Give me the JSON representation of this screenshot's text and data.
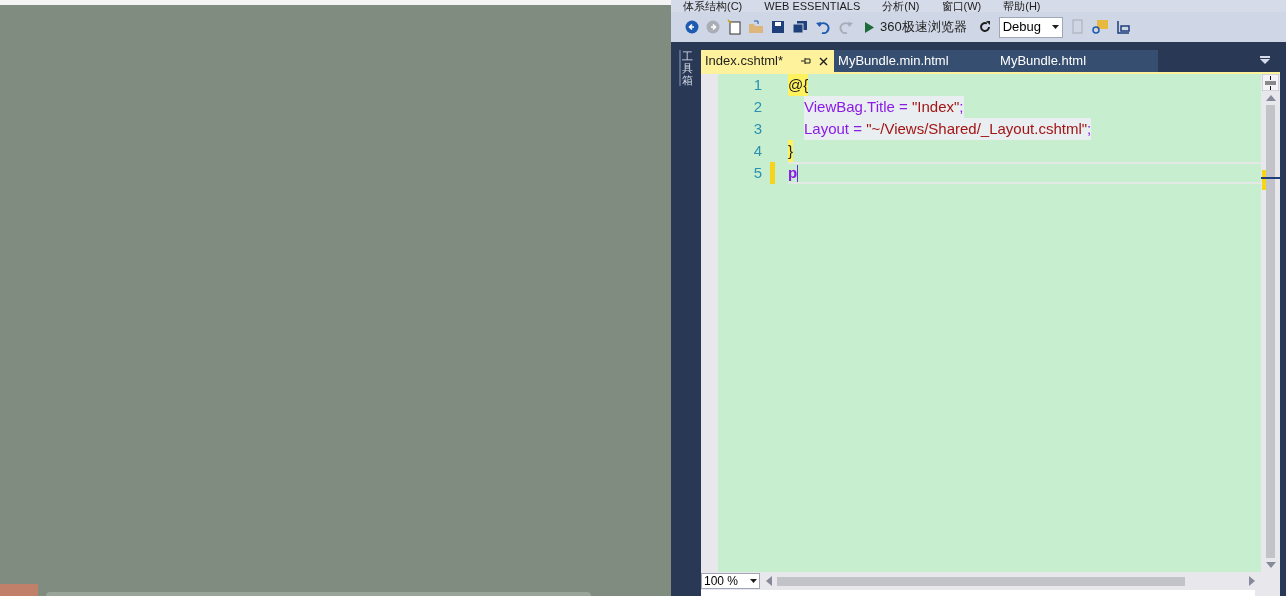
{
  "menu": [
    "体系结构(C)",
    "WEB ESSENTIALS",
    "分析(N)",
    "窗口(W)",
    "帮助(H)"
  ],
  "toolbar": {
    "browser": "360极速浏览器",
    "configuration": "Debug"
  },
  "toolbox_label": "工具箱",
  "tabs": [
    {
      "label": "Index.cshtml*",
      "selected": true
    },
    {
      "label": "MyBundle.min.html",
      "selected": false
    },
    {
      "label": "MyBundle.html",
      "selected": false
    }
  ],
  "lines": [
    {
      "number": "1",
      "current": false,
      "tokens": [
        {
          "text": "@{",
          "kind": "razor"
        }
      ]
    },
    {
      "number": "2",
      "current": false,
      "indent": true,
      "tokens": [
        {
          "text": "ViewBag.Title = ",
          "kind": "code"
        },
        {
          "text": "\"Index\"",
          "kind": "string"
        },
        {
          "text": ";",
          "kind": "code"
        }
      ]
    },
    {
      "number": "3",
      "current": false,
      "indent": true,
      "tokens": [
        {
          "text": "Layout = ",
          "kind": "code"
        },
        {
          "text": "\"~/Views/Shared/_Layout.cshtml\"",
          "kind": "string"
        },
        {
          "text": ";",
          "kind": "code"
        }
      ]
    },
    {
      "number": "4",
      "current": false,
      "tokens": [
        {
          "text": "}",
          "kind": "razor"
        }
      ]
    },
    {
      "number": "5",
      "current": true,
      "tokens": [
        {
          "text": "p",
          "kind": "tag"
        }
      ]
    }
  ],
  "zoom": "100 %"
}
